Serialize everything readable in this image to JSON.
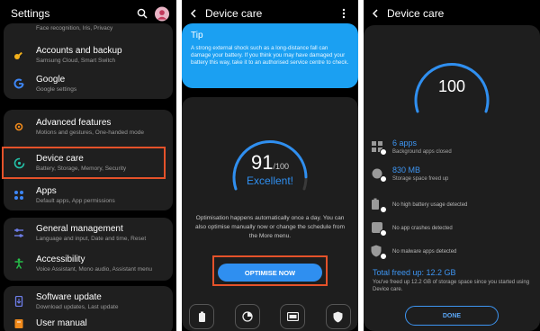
{
  "settings": {
    "title": "Settings",
    "top_sub": "Face recognition, Iris, Privacy",
    "items": [
      {
        "label": "Accounts and backup",
        "sub": "Samsung Cloud, Smart Switch",
        "icon": "key-icon",
        "color": "#f2b01b"
      },
      {
        "label": "Google",
        "sub": "Google settings",
        "icon": "google-icon",
        "color": "#3d86f5"
      },
      {
        "label": "Advanced features",
        "sub": "Motions and gestures, One-handed mode",
        "icon": "gear-plus-icon",
        "color": "#f08a1b"
      },
      {
        "label": "Device care",
        "sub": "Battery, Storage, Memory, Security",
        "icon": "device-care-icon",
        "color": "#24c2a9"
      },
      {
        "label": "Apps",
        "sub": "Default apps, App permissions",
        "icon": "apps-grid-icon",
        "color": "#3d86f5"
      },
      {
        "label": "General management",
        "sub": "Language and input, Date and time, Reset",
        "icon": "sliders-icon",
        "color": "#6e7eea"
      },
      {
        "label": "Accessibility",
        "sub": "Voice Assistant, Mono audio, Assistant menu",
        "icon": "accessibility-icon",
        "color": "#27c24a"
      },
      {
        "label": "Software update",
        "sub": "Download updates, Last update",
        "icon": "software-update-icon",
        "color": "#6e7eea"
      },
      {
        "label": "User manual",
        "sub": "",
        "icon": "user-manual-icon",
        "color": "#f08a1b"
      }
    ]
  },
  "device_care": {
    "title": "Device care",
    "tip_title": "Tip",
    "tip_body": "A strong external shock such as a long-distance fall can damage your battery. If you think you may have damaged your battery this way, take it to an authorised service centre to check.",
    "score": "91",
    "score_max": "/100",
    "score_value": 91,
    "status": "Excellent!",
    "description": "Optimisation happens automatically once a day. You can also optimise manually now or change the schedule from the More menu.",
    "optimise_label": "OPTIMISE NOW",
    "tiles": [
      "battery-icon",
      "storage-icon",
      "memory-icon",
      "security-icon"
    ]
  },
  "result": {
    "title": "Device care",
    "score": "100",
    "score_value": 100,
    "items": [
      {
        "value": "6 apps",
        "sub": "Background apps closed",
        "icon": "apps-closed-icon"
      },
      {
        "value": "830 MB",
        "sub": "Storage space freed up",
        "icon": "storage-freed-icon"
      },
      {
        "text": "No high battery usage detected",
        "icon": "battery-check-icon"
      },
      {
        "text": "No app crashes detected",
        "icon": "app-crash-check-icon"
      },
      {
        "text": "No malware apps detected",
        "icon": "malware-check-icon"
      }
    ],
    "total_title": "Total freed up: 12.2 GB",
    "total_desc": "You've freed up 12.2 GB of storage space since you started using Device care.",
    "done_label": "DONE"
  },
  "colors": {
    "accent": "#2f8ff0",
    "tip_bg": "#1ba0f2",
    "highlight": "#e5522a"
  }
}
